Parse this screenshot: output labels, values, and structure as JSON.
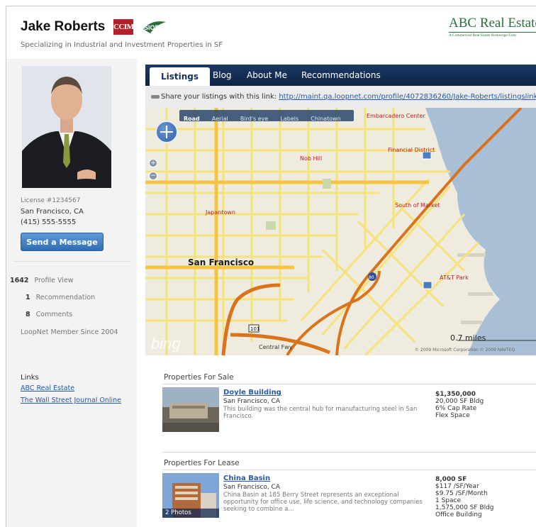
{
  "header": {
    "name": "Jake Roberts",
    "tagline": "Specializing in Industrial and Investment Properties in SF",
    "ccim_badge": "CCIM",
    "sior_badge": "SIOR",
    "company_logo": "ABC Real Estate, Inc.",
    "company_logo_sub": "A Commercial Real Estate Brokerage Firm"
  },
  "sidebar": {
    "license": "License #1234567",
    "city": "San Francisco, CA",
    "phone": "(415) 555-5555",
    "send_message": "Send a Message",
    "stats": {
      "profile_views_count": "1642",
      "profile_views_label": "Profile View",
      "recommendations_count": "1",
      "recommendations_label": "Recommendation",
      "comments_count": "8",
      "comments_label": "Comments"
    },
    "member_since": "LoopNet Member Since 2004",
    "links_heading": "Links",
    "links": [
      "ABC Real Estate",
      "The Wall Street Journal Online"
    ]
  },
  "tabs": [
    "Listings",
    "Blog",
    "About Me",
    "Recommendations"
  ],
  "share": {
    "text": "Share your listings with this link:",
    "url": "http://maint.qa.loopnet.com/profile/4072836260/Jake-Roberts/listingslink"
  },
  "map": {
    "modes": [
      "Road",
      "Aerial",
      "Bird's eye",
      "Labels",
      "Chinatown"
    ],
    "labels": {
      "san_francisco": "San Francisco",
      "embarcadero": "Embarcadero Center",
      "financial_district": "Financial District",
      "nob_hill": "Nob Hill",
      "japantown": "Japantown",
      "south_of_market": "South of Market",
      "att_park": "AT&T Park",
      "central_fwy": "Central Fwy",
      "hwy_101": "101",
      "hwy_80": "80"
    },
    "scale": "0.7 miles",
    "brand": "bing",
    "copyright": "© 2009 Microsoft Corporation  © 2009 NAVTEQ"
  },
  "for_sale": {
    "heading": "Properties For Sale",
    "items": [
      {
        "title": "Doyle Building",
        "city": "San Francisco, CA",
        "desc": "This building was the central hub for manufacturing steel in San Francisco.",
        "facts": [
          "$1,350,000",
          "20,000 SF Bldg",
          "6% Cap Rate",
          "Flex Space"
        ]
      }
    ]
  },
  "for_lease": {
    "heading": "Properties For Lease",
    "items": [
      {
        "title": "China Basin",
        "city": "San Francisco, CA",
        "desc": "China Basin at 185 Berry Street represents an exceptional opportunity for office use, life science, and technology companies seeking to combine a...",
        "photos": "2 Photos",
        "facts": [
          "8,000 SF",
          "$117 /SF/Year",
          "$9.75 /SF/Month",
          "1 Space",
          "1,575,000 SF Bldg",
          "Office Building"
        ]
      }
    ]
  },
  "colors": {
    "tab_bar": "#15305a",
    "link": "#2659a8",
    "button": "#3a7bc8",
    "ccim_red": "#b6202a",
    "brand_green": "#2c6e3c",
    "freeway": "#d9731e"
  }
}
